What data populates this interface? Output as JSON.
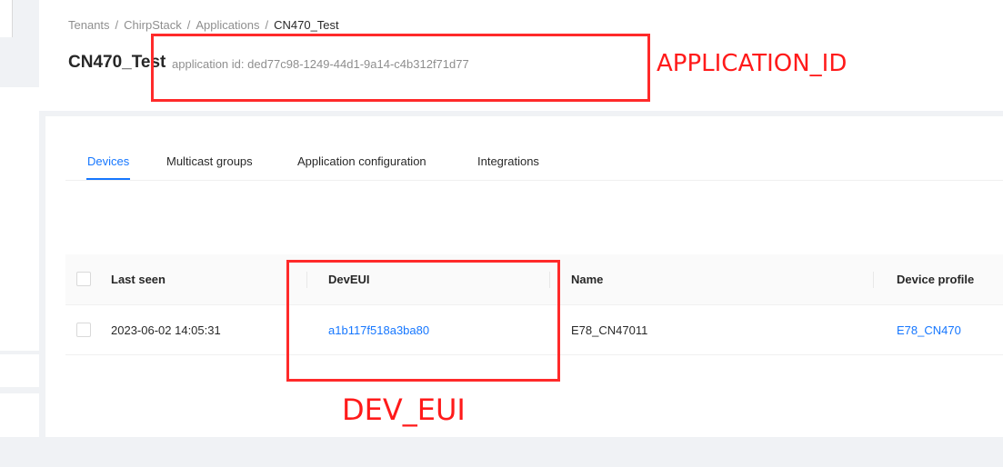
{
  "breadcrumb": {
    "items": [
      "Tenants",
      "ChirpStack",
      "Applications",
      "CN470_Test"
    ],
    "separator": "/"
  },
  "header": {
    "title": "CN470_Test",
    "subtitle": "application id: ded77c98-1249-44d1-9a14-c4b312f71d77"
  },
  "tabs": [
    {
      "label": "Devices",
      "active": true
    },
    {
      "label": "Multicast groups",
      "active": false
    },
    {
      "label": "Application configuration",
      "active": false
    },
    {
      "label": "Integrations",
      "active": false
    }
  ],
  "table": {
    "columns": [
      "Last seen",
      "DevEUI",
      "Name",
      "Device profile"
    ],
    "rows": [
      {
        "last_seen": "2023-06-02 14:05:31",
        "dev_eui": "a1b117f518a3ba80",
        "name": "E78_CN47011",
        "device_profile": "E78_CN470"
      }
    ]
  },
  "annotations": {
    "application_id_label": "APPLICATION_ID",
    "dev_eui_label": "DEV_EUI"
  },
  "colors": {
    "accent": "#1677ff",
    "annotation": "#ff1a1a",
    "background": "#f0f2f5"
  }
}
